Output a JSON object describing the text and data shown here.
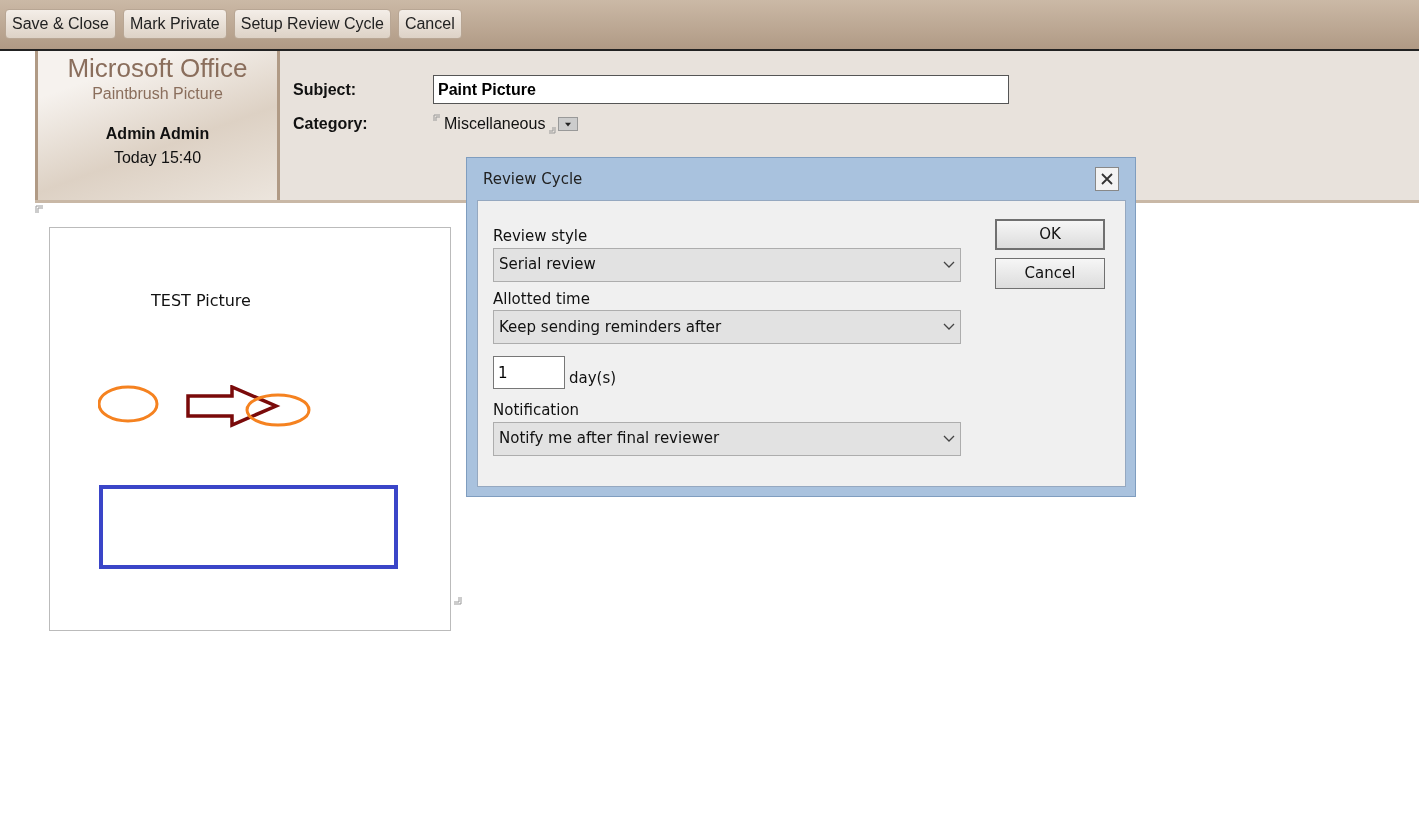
{
  "toolbar": {
    "buttons": [
      "Save & Close",
      "Mark Private",
      "Setup Review Cycle",
      "Cancel"
    ]
  },
  "header": {
    "app_title": "Microsoft Office",
    "item_type": "Paintbrush Picture",
    "author": "Admin Admin",
    "time": "Today 15:40"
  },
  "fields": {
    "subject_label": "Subject:",
    "subject_value": "Paint Picture",
    "category_label": "Category:",
    "category_value": "Miscellaneous"
  },
  "picture_box": {
    "caption": "TEST Picture"
  },
  "dialog": {
    "title": "Review Cycle",
    "rows": [
      {
        "kind": "select",
        "label": "Review style",
        "value": "Serial review"
      },
      {
        "kind": "select",
        "label": "Allotted time",
        "value": "Keep sending reminders after"
      },
      {
        "kind": "number",
        "value": "1",
        "unit": "day(s)"
      },
      {
        "kind": "select",
        "label": "Notification",
        "value": "Notify me after final reviewer"
      }
    ],
    "buttons": [
      "OK",
      "Cancel"
    ]
  }
}
